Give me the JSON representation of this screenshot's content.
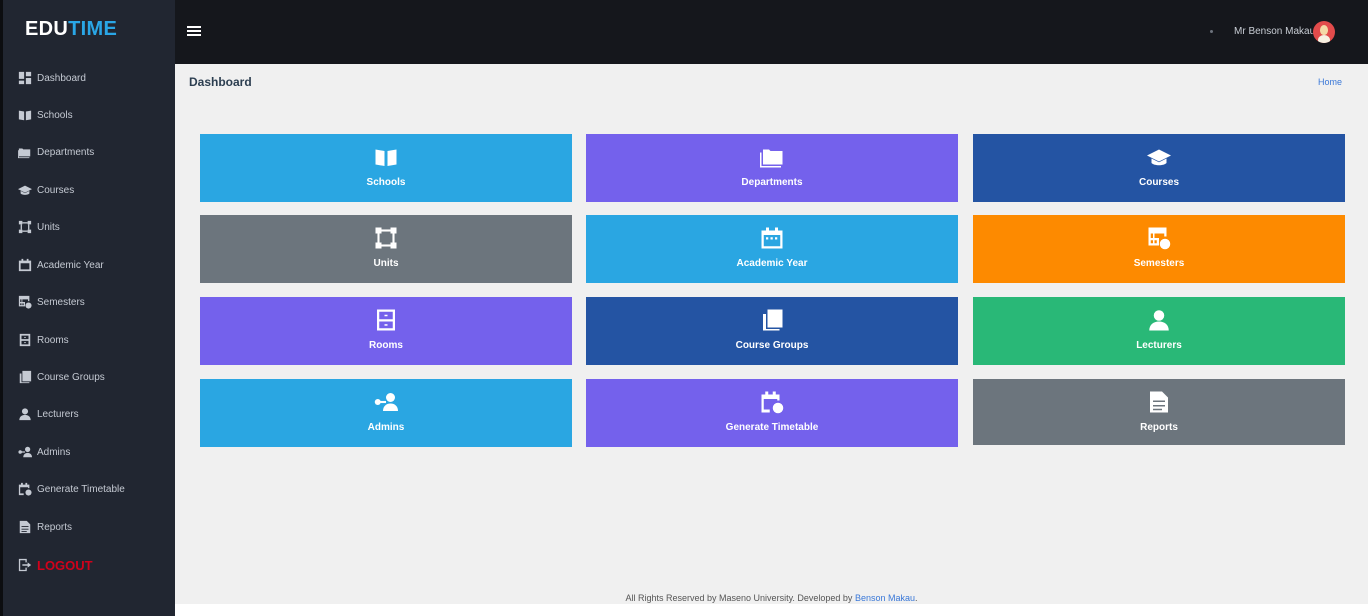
{
  "brand": {
    "part1": "EDU",
    "part2": "TIME"
  },
  "sidebar": {
    "items": [
      {
        "label": "Dashboard",
        "icon": "dashboard-icon"
      },
      {
        "label": "Schools",
        "icon": "book-open-icon"
      },
      {
        "label": "Departments",
        "icon": "folder-icon"
      },
      {
        "label": "Courses",
        "icon": "graduation-cap-icon"
      },
      {
        "label": "Units",
        "icon": "vector-square-icon"
      },
      {
        "label": "Academic Year",
        "icon": "calendar-icon"
      },
      {
        "label": "Semesters",
        "icon": "table-clock-icon"
      },
      {
        "label": "Rooms",
        "icon": "cabinet-icon"
      },
      {
        "label": "Course Groups",
        "icon": "books-icon"
      },
      {
        "label": "Lecturers",
        "icon": "user-icon"
      },
      {
        "label": "Admins",
        "icon": "user-key-icon"
      },
      {
        "label": "Generate Timetable",
        "icon": "calendar-clock-icon"
      },
      {
        "label": "Reports",
        "icon": "file-icon"
      }
    ],
    "logout": "LOGOUT"
  },
  "topbar": {
    "user_name": "Mr Benson Makau"
  },
  "page": {
    "title": "Dashboard",
    "breadcrumb": "Home"
  },
  "tiles": [
    {
      "label": "Schools",
      "icon": "book-open-icon",
      "color": "#2aa6e2"
    },
    {
      "label": "Departments",
      "icon": "folder-icon",
      "color": "#7461ec"
    },
    {
      "label": "Courses",
      "icon": "graduation-cap-icon",
      "color": "#2454a3"
    },
    {
      "label": "Units",
      "icon": "vector-square-icon",
      "color": "#6c757d"
    },
    {
      "label": "Academic Year",
      "icon": "calendar-icon",
      "color": "#2aa6e2"
    },
    {
      "label": "Semesters",
      "icon": "table-clock-icon",
      "color": "#fd8a00"
    },
    {
      "label": "Rooms",
      "icon": "cabinet-icon",
      "color": "#7461ec"
    },
    {
      "label": "Course Groups",
      "icon": "books-icon",
      "color": "#2454a3"
    },
    {
      "label": "Lecturers",
      "icon": "user-icon",
      "color": "#29b877"
    },
    {
      "label": "Admins",
      "icon": "user-key-icon",
      "color": "#2aa6e2"
    },
    {
      "label": "Generate Timetable",
      "icon": "calendar-clock-icon",
      "color": "#7461ec"
    },
    {
      "label": "Reports",
      "icon": "file-icon",
      "color": "#6c757d"
    }
  ],
  "footer": {
    "text": "All Rights Reserved by Maseno University. Developed by ",
    "link": "Benson Makau",
    "end": "."
  }
}
